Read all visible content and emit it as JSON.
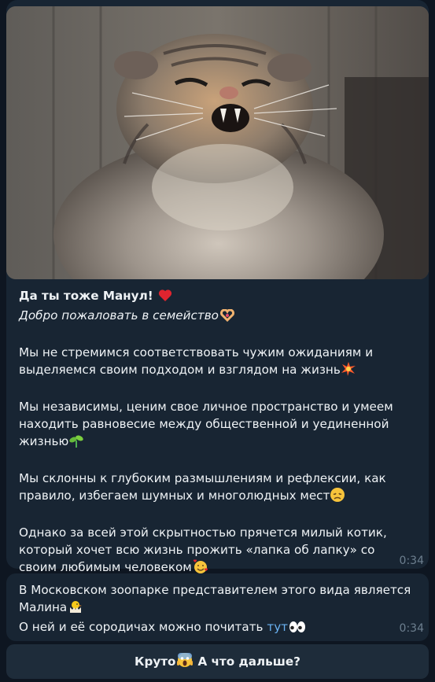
{
  "message1": {
    "title": "Да ты тоже Манул!",
    "subtitle": "Добро пожаловать в семейство",
    "paragraphs": [
      "Мы не стремимся соответствовать чужим ожиданиям и выделяемся своим подходом и взглядом на жизнь",
      "Мы независимы, ценим свое личное пространство и умеем находить равновесие между общественной и уединенной жизнью",
      "Мы склонны к глубоким размышлениям и рефлексии, как правило, избегаем шумных и многолюдных мест",
      "Однако за всей этой скрытностью прячется милый котик, который хочет всю жизнь прожить «лапка об лапку» со своим любимым человеком"
    ],
    "time": "0:34"
  },
  "message2": {
    "line1": "В Московском зоопарке представителем этого вида является Малина",
    "line2_prefix": "О ней и её сородичах можно почитать",
    "link_text": "тут",
    "time": "0:34"
  },
  "button": {
    "label_prefix": "Круто",
    "label_suffix": "А что дальше?"
  },
  "colors": {
    "background": "#0e1621",
    "bubble": "#182533",
    "link": "#6ab2f2",
    "time": "#6d7f8f"
  },
  "icons": [
    "red-heart-icon",
    "heart-hands-icon",
    "collision-icon",
    "seedling-icon",
    "disappointed-face-icon",
    "smiling-face-with-hearts-icon",
    "hatching-chick-icon",
    "eyes-icon",
    "screaming-face-icon"
  ]
}
